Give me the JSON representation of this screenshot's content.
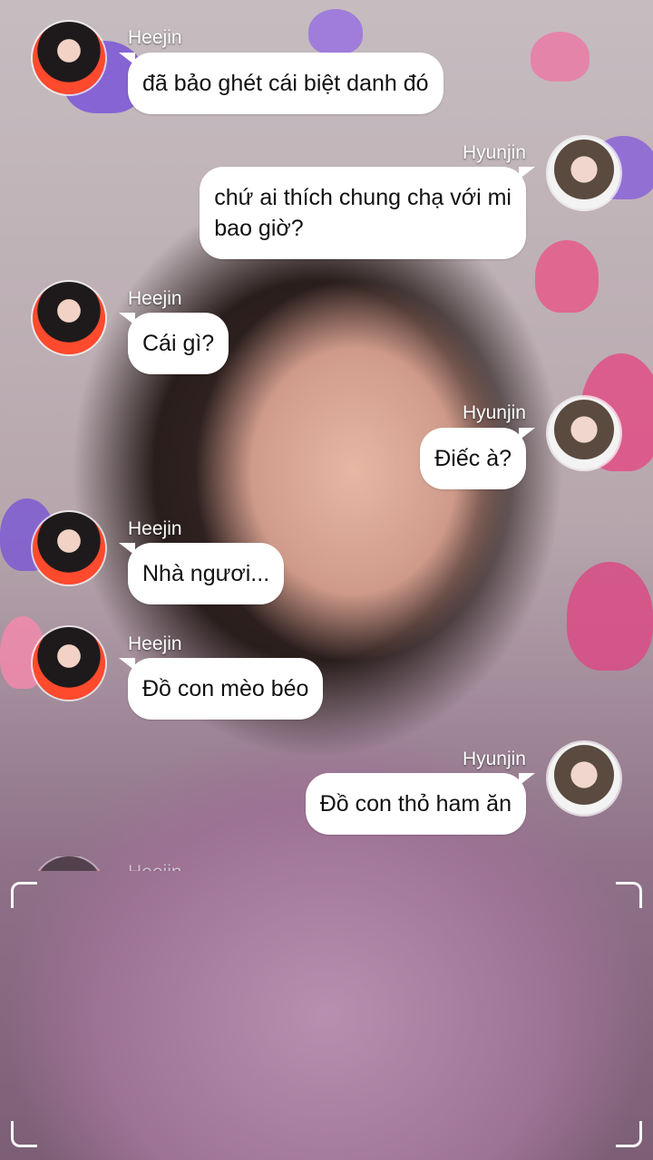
{
  "conversation": {
    "messages": [
      {
        "sender": "Heejin",
        "text": "đã bảo ghét cái biệt danh đó"
      },
      {
        "sender": "Hyunjin",
        "text_lines": [
          "chứ ai thích chung chạ với mi",
          "bao giờ?"
        ]
      },
      {
        "sender": "Heejin",
        "text": "Cái gì?"
      },
      {
        "sender": "Hyunjin",
        "text": "Điếc à?"
      },
      {
        "sender": "Heejin",
        "text": "Nhà ngươi..."
      },
      {
        "sender": "Heejin",
        "text": "Đồ con mèo béo"
      },
      {
        "sender": "Hyunjin",
        "text": "Đồ con thỏ ham ăn"
      },
      {
        "sender": "Heejin",
        "text": ""
      }
    ]
  }
}
